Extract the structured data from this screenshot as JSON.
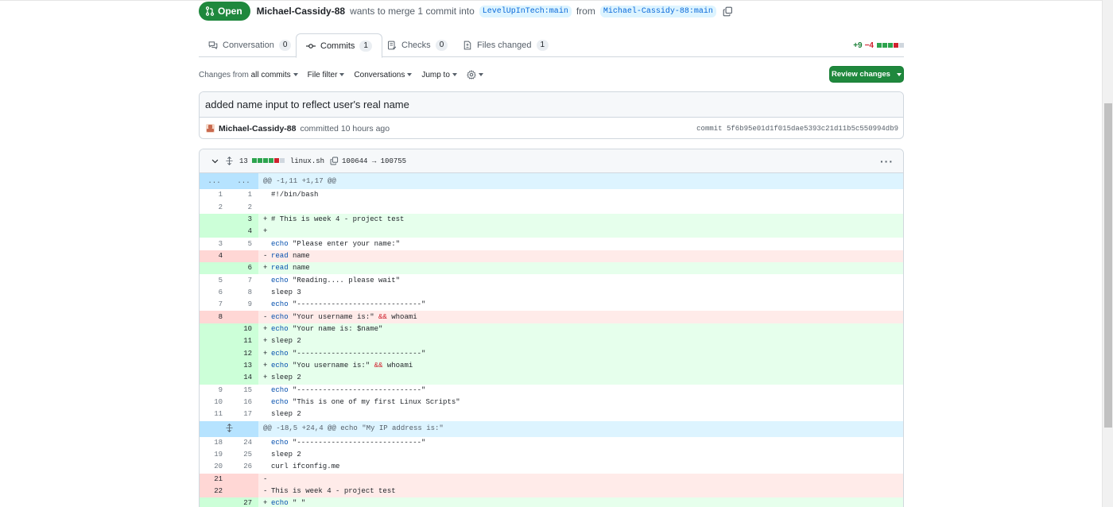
{
  "pr": {
    "state": "Open",
    "author": "Michael-Cassidy-88",
    "summary": "wants to merge 1 commit into",
    "base_branch": "LevelUpInTech:main",
    "from_word": "from",
    "head_branch": "Michael-Cassidy-88:main"
  },
  "tabs": [
    {
      "label": "Conversation",
      "count": "0"
    },
    {
      "label": "Commits",
      "count": "1"
    },
    {
      "label": "Checks",
      "count": "0"
    },
    {
      "label": "Files changed",
      "count": "1"
    }
  ],
  "diffstat": {
    "additions": "+9",
    "deletions": "−4"
  },
  "toolbar": {
    "changes_from": "Changes from",
    "all_commits": "all commits",
    "file_filter": "File filter",
    "conversations": "Conversations",
    "jump_to": "Jump to",
    "review_changes": "Review changes"
  },
  "commit": {
    "title": "added name input to reflect user's real name",
    "author": "Michael-Cassidy-88",
    "action": "committed 10 hours ago",
    "sha": "commit 5f6b95e01d1f015dae5393c21d11b5c550994db9"
  },
  "file": {
    "changes": "13",
    "name": "linux.sh",
    "mode": "100644 → 100755"
  },
  "hunk1": {
    "left": "...",
    "right": "...",
    "header": "@@ -1,11 +1,17 @@"
  },
  "hunk2": {
    "header": "@@ -18,5 +24,4 @@ echo \"My IP address is:\""
  },
  "lines": [
    {
      "type": "ctx",
      "old": "1",
      "new": "1",
      "mark": " ",
      "text": "#!/bin/bash"
    },
    {
      "type": "ctx",
      "old": "2",
      "new": "2",
      "mark": " ",
      "text": ""
    },
    {
      "type": "add",
      "old": "",
      "new": "3",
      "mark": "+",
      "text": "# This is week 4 - project test"
    },
    {
      "type": "add",
      "old": "",
      "new": "4",
      "mark": "+",
      "text": ""
    },
    {
      "type": "ctx",
      "old": "3",
      "new": "5",
      "mark": " ",
      "kw": "echo",
      "text": " \"Please enter your name:\""
    },
    {
      "type": "del",
      "old": "4",
      "new": "",
      "mark": "-",
      "kw": "read",
      "text": " name"
    },
    {
      "type": "add",
      "old": "",
      "new": "6",
      "mark": "+",
      "kw": "read",
      "text": " name"
    },
    {
      "type": "ctx",
      "old": "5",
      "new": "7",
      "mark": " ",
      "kw": "echo",
      "text": " \"Reading.... please wait\""
    },
    {
      "type": "ctx",
      "old": "6",
      "new": "8",
      "mark": " ",
      "text": "sleep 3"
    },
    {
      "type": "ctx",
      "old": "7",
      "new": "9",
      "mark": " ",
      "kw": "echo",
      "text": " \"-----------------------------\""
    },
    {
      "type": "del",
      "old": "8",
      "new": "",
      "mark": "-",
      "kw": "echo",
      "text": " \"Your username is:\" && whoami"
    },
    {
      "type": "add",
      "old": "",
      "new": "10",
      "mark": "+",
      "kw": "echo",
      "text": " \"Your name is: $name\""
    },
    {
      "type": "add",
      "old": "",
      "new": "11",
      "mark": "+",
      "text": "sleep 2"
    },
    {
      "type": "add",
      "old": "",
      "new": "12",
      "mark": "+",
      "kw": "echo",
      "text": " \"-----------------------------\""
    },
    {
      "type": "add",
      "old": "",
      "new": "13",
      "mark": "+",
      "kw": "echo",
      "text": " \"You username is:\" && whoami"
    },
    {
      "type": "add",
      "old": "",
      "new": "14",
      "mark": "+",
      "text": "sleep 2"
    },
    {
      "type": "ctx",
      "old": "9",
      "new": "15",
      "mark": " ",
      "kw": "echo",
      "text": " \"-----------------------------\""
    },
    {
      "type": "ctx",
      "old": "10",
      "new": "16",
      "mark": " ",
      "kw": "echo",
      "text": " \"This is one of my first Linux Scripts\""
    },
    {
      "type": "ctx",
      "old": "11",
      "new": "17",
      "mark": " ",
      "text": "sleep 2"
    }
  ],
  "lines2": [
    {
      "type": "ctx",
      "old": "18",
      "new": "24",
      "mark": " ",
      "kw": "echo",
      "text": " \"-----------------------------\""
    },
    {
      "type": "ctx",
      "old": "19",
      "new": "25",
      "mark": " ",
      "text": "sleep 2"
    },
    {
      "type": "ctx",
      "old": "20",
      "new": "26",
      "mark": " ",
      "text": "curl ifconfig.me"
    },
    {
      "type": "del",
      "old": "21",
      "new": "",
      "mark": "-",
      "text": ""
    },
    {
      "type": "del",
      "old": "22",
      "new": "",
      "mark": "-",
      "text": "This is week 4 - project test"
    },
    {
      "type": "add",
      "old": "",
      "new": "27",
      "mark": "+",
      "kw": "echo",
      "text": " \" \""
    }
  ],
  "colors": {
    "green": "#1f883d",
    "add_bg": "#e6ffec",
    "del_bg": "#ffebe9",
    "hunk_bg": "#ddf4ff"
  }
}
